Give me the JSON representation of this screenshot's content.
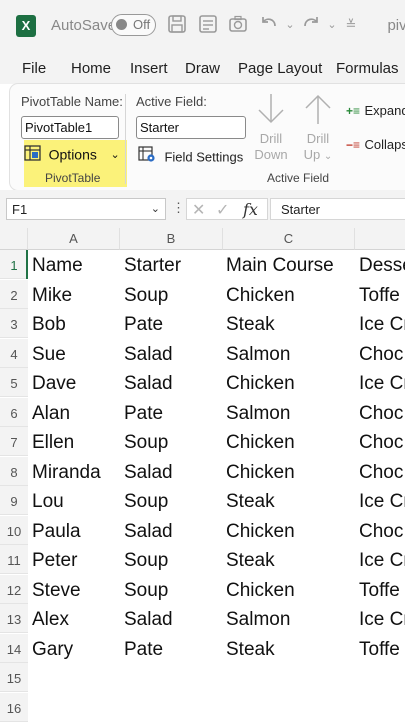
{
  "titlebar": {
    "autosave_label": "AutoSave",
    "toggle_state": "Off",
    "file_name": "pivo",
    "app_icon_letter": "X"
  },
  "tabs": [
    "File",
    "Home",
    "Insert",
    "Draw",
    "Page Layout",
    "Formulas"
  ],
  "ribbon": {
    "pivottable_name_label": "PivotTable Name:",
    "pivottable_name_value": "PivotTable1",
    "options_label": "Options",
    "pivottable_group_label": "PivotTable",
    "active_field_label": "Active Field:",
    "active_field_value": "Starter",
    "field_settings_label": "Field Settings",
    "drill_down_line1": "Drill",
    "drill_down_line2": "Down",
    "drill_up_line1": "Drill",
    "drill_up_line2": "Up",
    "active_field_group_label": "Active Field",
    "expand_label": "Expand",
    "collapse_label": "Collaps",
    "highlight_color": "#fbf27a"
  },
  "formula_bar": {
    "name_box": "F1",
    "fx_label": "fx",
    "formula": "Starter"
  },
  "columns": [
    "A",
    "B",
    "C",
    ""
  ],
  "rows": [
    {
      "num": "1",
      "cells": [
        "Name",
        "Starter",
        "Main Course",
        "Desse"
      ]
    },
    {
      "num": "2",
      "cells": [
        "Mike",
        "Soup",
        "Chicken",
        "Toffe"
      ]
    },
    {
      "num": "3",
      "cells": [
        "Bob",
        "Pate",
        "Steak",
        "Ice Cr"
      ]
    },
    {
      "num": "4",
      "cells": [
        "Sue",
        "Salad",
        "Salmon",
        "Choc"
      ]
    },
    {
      "num": "5",
      "cells": [
        "Dave",
        "Salad",
        "Chicken",
        "Ice Cr"
      ]
    },
    {
      "num": "6",
      "cells": [
        "Alan",
        "Pate",
        "Salmon",
        "Choc"
      ]
    },
    {
      "num": "7",
      "cells": [
        "Ellen",
        "Soup",
        "Chicken",
        "Choc"
      ]
    },
    {
      "num": "8",
      "cells": [
        "Miranda",
        "Salad",
        "Chicken",
        "Choc"
      ]
    },
    {
      "num": "9",
      "cells": [
        "Lou",
        "Soup",
        "Steak",
        "Ice Cr"
      ]
    },
    {
      "num": "10",
      "cells": [
        "Paula",
        "Salad",
        "Chicken",
        "Choc"
      ]
    },
    {
      "num": "11",
      "cells": [
        "Peter",
        "Soup",
        "Steak",
        "Ice Cr"
      ]
    },
    {
      "num": "12",
      "cells": [
        "Steve",
        "Soup",
        "Chicken",
        "Toffe"
      ]
    },
    {
      "num": "13",
      "cells": [
        "Alex",
        "Salad",
        "Salmon",
        "Ice Cr"
      ]
    },
    {
      "num": "14",
      "cells": [
        "Gary",
        "Pate",
        "Steak",
        "Toffe"
      ]
    },
    {
      "num": "15",
      "cells": [
        "",
        "",
        "",
        ""
      ]
    },
    {
      "num": "16",
      "cells": [
        "",
        "",
        "",
        ""
      ]
    }
  ]
}
